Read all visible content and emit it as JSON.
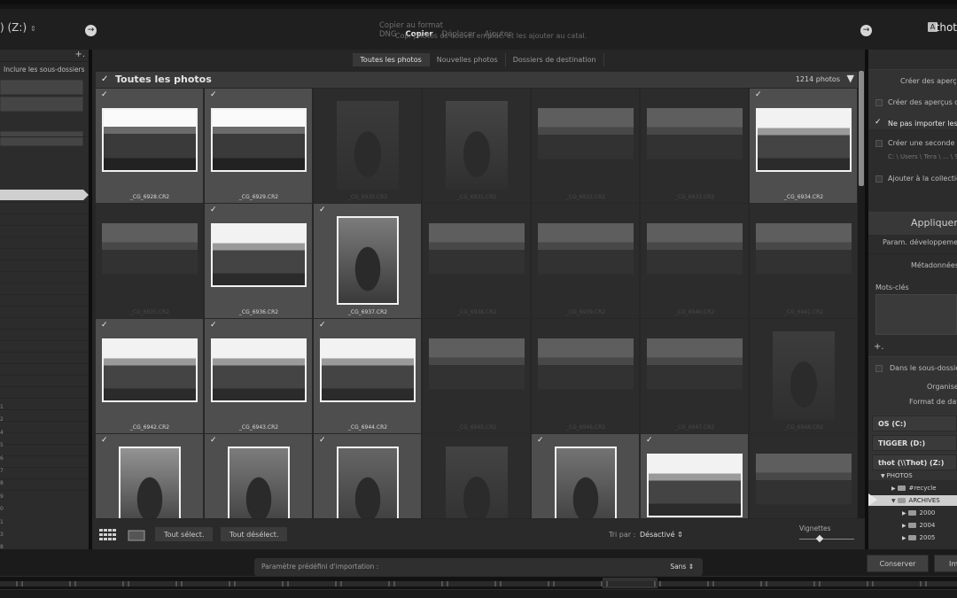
{
  "topbar": {
    "source_label": ") (Z:)",
    "source_arrow": "⇕",
    "destination_label": "thot",
    "destination_badge": "A",
    "left_arrow": "→",
    "right_arrow": "→",
    "modes": [
      "Copier au format DNG",
      "Copier",
      "Déplacer",
      "Ajouter"
    ],
    "active_mode": "Copier",
    "mode_description": "Cop. photos ds nouvel emplac. et les ajouter au catal."
  },
  "left_panel": {
    "plus": "+.",
    "include_subfolders": "Inclure les sous-dossiers",
    "numbers": [
      "1",
      "2",
      "4",
      "5",
      "6",
      "7",
      "8",
      "9",
      "0",
      "1",
      "3",
      "8",
      "9"
    ]
  },
  "center": {
    "tabs": [
      "Toutes les photos",
      "Nouvelles photos",
      "Dossiers de destination"
    ],
    "active_tab": "Toutes les photos",
    "header_check": "✓",
    "header_title": "Toutes les photos",
    "photo_count": "1214 photos",
    "header_triangle": "▼",
    "thumbnails": [
      {
        "file": "_CG_6928.CR2",
        "checked": true,
        "tone": "car"
      },
      {
        "file": "_CG_6929.CR2",
        "checked": true,
        "tone": "car"
      },
      {
        "file": "_CG_6930.CR2",
        "checked": false,
        "tone": "portrait"
      },
      {
        "file": "_CG_6931.CR2",
        "checked": false,
        "tone": "portrait"
      },
      {
        "file": "_CG_6932.CR2",
        "checked": false,
        "tone": "crowd"
      },
      {
        "file": "_CG_6933.CR2",
        "checked": false,
        "tone": "crowd"
      },
      {
        "file": "_CG_6934.CR2",
        "checked": true,
        "tone": "crowd"
      },
      {
        "file": "_CG_6935.CR2",
        "checked": false,
        "tone": "crowd"
      },
      {
        "file": "_CG_6936.CR2",
        "checked": true,
        "tone": "crowd"
      },
      {
        "file": "_CG_6937.CR2",
        "checked": true,
        "tone": "portrait"
      },
      {
        "file": "_CG_6938.CR2",
        "checked": false,
        "tone": "crowd"
      },
      {
        "file": "_CG_6939.CR2",
        "checked": false,
        "tone": "crowd"
      },
      {
        "file": "_CG_6940.CR2",
        "checked": false,
        "tone": "crowd"
      },
      {
        "file": "_CG_6941.CR2",
        "checked": false,
        "tone": "crowd"
      },
      {
        "file": "_CG_6942.CR2",
        "checked": true,
        "tone": "crowd"
      },
      {
        "file": "_CG_6943.CR2",
        "checked": true,
        "tone": "crowd"
      },
      {
        "file": "_CG_6944.CR2",
        "checked": true,
        "tone": "crowd"
      },
      {
        "file": "_CG_6945.CR2",
        "checked": false,
        "tone": "crowd"
      },
      {
        "file": "_CG_6946.CR2",
        "checked": false,
        "tone": "crowd"
      },
      {
        "file": "_CG_6947.CR2",
        "checked": false,
        "tone": "crowd"
      },
      {
        "file": "_CG_6948.CR2",
        "checked": false,
        "tone": "portrait"
      },
      {
        "file": "",
        "checked": true,
        "tone": "portrait"
      },
      {
        "file": "",
        "checked": true,
        "tone": "portrait"
      },
      {
        "file": "",
        "checked": true,
        "tone": "portrait"
      },
      {
        "file": "",
        "checked": false,
        "tone": "portrait"
      },
      {
        "file": "",
        "checked": true,
        "tone": "portrait"
      },
      {
        "file": "",
        "checked": true,
        "tone": "crowd"
      },
      {
        "file": "",
        "checked": false,
        "tone": "crowd"
      }
    ],
    "select_all": "Tout sélect.",
    "deselect_all": "Tout désélect.",
    "sort_label": "Tri par :",
    "sort_value": "Désactivé ⇕",
    "thumbnail_label": "Vignettes"
  },
  "right_panel": {
    "create_previews": "Créer des aperçus",
    "create_smart_previews": "Créer des aperçus dyna",
    "dont_import_duplicates": "Ne pas importer les é",
    "second_copy": "Créer une seconde cop",
    "second_copy_path": "C: \\ Users \\ Tera \\ ... \\ S",
    "add_to_collection": "Ajouter à la collection",
    "apply_header": "Appliquer p",
    "develop_settings": "Param. développement",
    "metadata": "Métadonnées",
    "keywords": "Mots-clés",
    "plus": "+.",
    "in_subfolder": "Dans le sous-dossier",
    "organize": "Organiser",
    "date_format": "Format de date",
    "drives": [
      "OS (C:)",
      "TIGGER (D:)",
      "thot (\\\\Thot) (Z:)"
    ],
    "folders": [
      {
        "name": "PHOTOS",
        "indent": 0,
        "arrow": "▼"
      },
      {
        "name": "#recycle",
        "indent": 1,
        "arrow": "▶"
      },
      {
        "name": "ARCHIVES",
        "indent": 1,
        "arrow": "▼"
      },
      {
        "name": "2000",
        "indent": 2,
        "arrow": "▶"
      },
      {
        "name": "2004",
        "indent": 2,
        "arrow": "▶"
      },
      {
        "name": "2005",
        "indent": 2,
        "arrow": "▶"
      }
    ]
  },
  "bottom": {
    "preset_label": "Paramètre prédéfini d'importation :",
    "preset_value": "Sans ⇕",
    "keep_button": "Conserver",
    "import_button": "Im"
  }
}
